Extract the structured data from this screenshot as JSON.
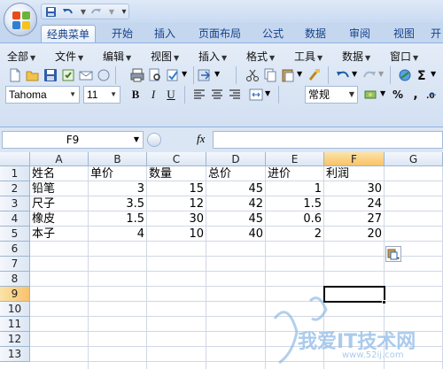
{
  "qat": {
    "icons": [
      "save-icon",
      "undo-icon",
      "redo-icon",
      "customize-icon"
    ]
  },
  "tabs": [
    "经典菜单",
    "开始",
    "插入",
    "页面布局",
    "公式",
    "数据",
    "审阅",
    "视图",
    "开"
  ],
  "menus": [
    "全部",
    "文件",
    "编辑",
    "视图",
    "插入",
    "格式",
    "工具",
    "数据",
    "窗口"
  ],
  "font": {
    "name": "Tahoma",
    "size": "11",
    "number_format": "常规"
  },
  "format_buttons": {
    "bold": "B",
    "italic": "I",
    "underline": "U",
    "percent": "%",
    "comma": ","
  },
  "formula_bar": {
    "name_box": "F9",
    "fx": "fx",
    "value": ""
  },
  "columns": [
    "A",
    "B",
    "C",
    "D",
    "E",
    "F",
    "G"
  ],
  "rows": [
    "1",
    "2",
    "3",
    "4",
    "5",
    "6",
    "7",
    "8",
    "9",
    "10",
    "11",
    "12",
    "13"
  ],
  "selected": {
    "column": "F",
    "row": "9",
    "cell": "F9"
  },
  "table": {
    "headers": [
      "姓名",
      "单价",
      "数量",
      "总价",
      "进价",
      "利润"
    ],
    "rows": [
      [
        "铅笔",
        "3",
        "15",
        "45",
        "1",
        "30"
      ],
      [
        "尺子",
        "3.5",
        "12",
        "42",
        "1.5",
        "24"
      ],
      [
        "橡皮",
        "1.5",
        "30",
        "45",
        "0.6",
        "27"
      ],
      [
        "本子",
        "4",
        "10",
        "40",
        "2",
        "20"
      ]
    ]
  },
  "watermark": {
    "text": "我爱IT技术网",
    "url": "www.52ij.com"
  },
  "colors": {
    "accent": "#15428b",
    "selected_header": "#f9c26a",
    "ribbon": "#d2e0f2"
  }
}
